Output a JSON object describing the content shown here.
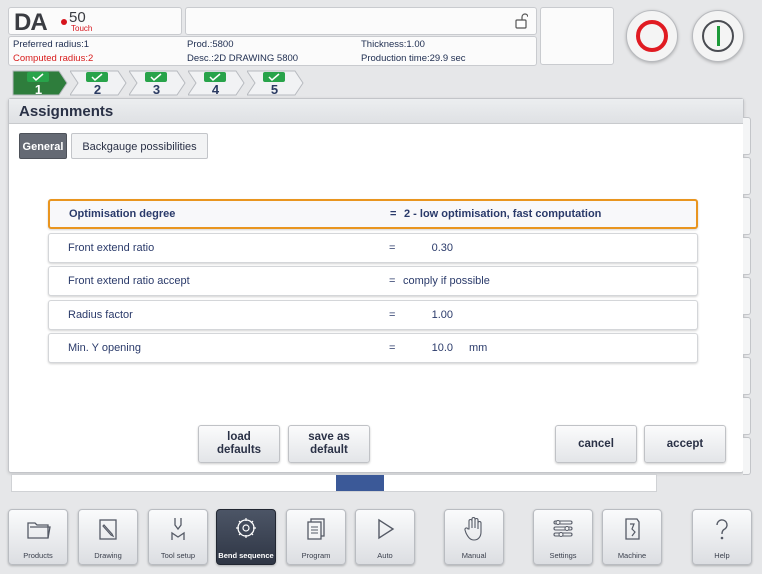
{
  "header": {
    "logo_text": "DA",
    "logo_number": "50",
    "logo_sub": "Touch",
    "preferred_radius": "Preferred radius:1",
    "computed_radius": "Computed radius:2",
    "product": "Prod.:5800",
    "description": "Desc.:2D DRAWING 5800",
    "thickness": "Thickness:1.00",
    "production_time": "Production time:29.9 sec"
  },
  "steps": [
    {
      "label": "1",
      "status": "ok",
      "active": true
    },
    {
      "label": "2",
      "status": "ok",
      "active": false
    },
    {
      "label": "3",
      "status": "ok",
      "active": false
    },
    {
      "label": "4",
      "status": "ok",
      "active": false
    },
    {
      "label": "5",
      "status": "ok",
      "active": false
    }
  ],
  "panel": {
    "title": "Assignments",
    "tabs": [
      "General",
      "Backgauge possibilities"
    ]
  },
  "params": [
    {
      "label": "Optimisation degree",
      "eq": "=",
      "value": "2 - low optimisation, fast computation",
      "unit": ""
    },
    {
      "label": "Front extend ratio",
      "eq": "=",
      "value": "0.30",
      "unit": ""
    },
    {
      "label": "Front extend ratio accept",
      "eq": "=",
      "value": "comply if possible",
      "unit": ""
    },
    {
      "label": "Radius factor",
      "eq": "=",
      "value": "1.00",
      "unit": ""
    },
    {
      "label": "Min. Y opening",
      "eq": "=",
      "value": "10.0",
      "unit": "mm"
    }
  ],
  "buttons": {
    "load_defaults": "load\ndefaults",
    "save_as_default": "save as\ndefault",
    "cancel": "cancel",
    "accept": "accept"
  },
  "nav": [
    {
      "label": "Products",
      "icon": "folder-icon"
    },
    {
      "label": "Drawing",
      "icon": "pencil-icon"
    },
    {
      "label": "Tool setup",
      "icon": "tool-icon"
    },
    {
      "label": "Bend sequence",
      "icon": "bend-sequence-icon"
    },
    {
      "label": "Program",
      "icon": "program-icon"
    },
    {
      "label": "Auto",
      "icon": "play-icon"
    },
    {
      "label": "Manual",
      "icon": "hand-icon"
    },
    {
      "label": "Settings",
      "icon": "settings-icon"
    },
    {
      "label": "Machine",
      "icon": "machine-icon"
    },
    {
      "label": "Help",
      "icon": "help-icon"
    }
  ],
  "colors": {
    "accent": "#e9951f",
    "ok_badge": "#28a34a",
    "stop": "#e01b22",
    "start": "#1d9a3a"
  }
}
